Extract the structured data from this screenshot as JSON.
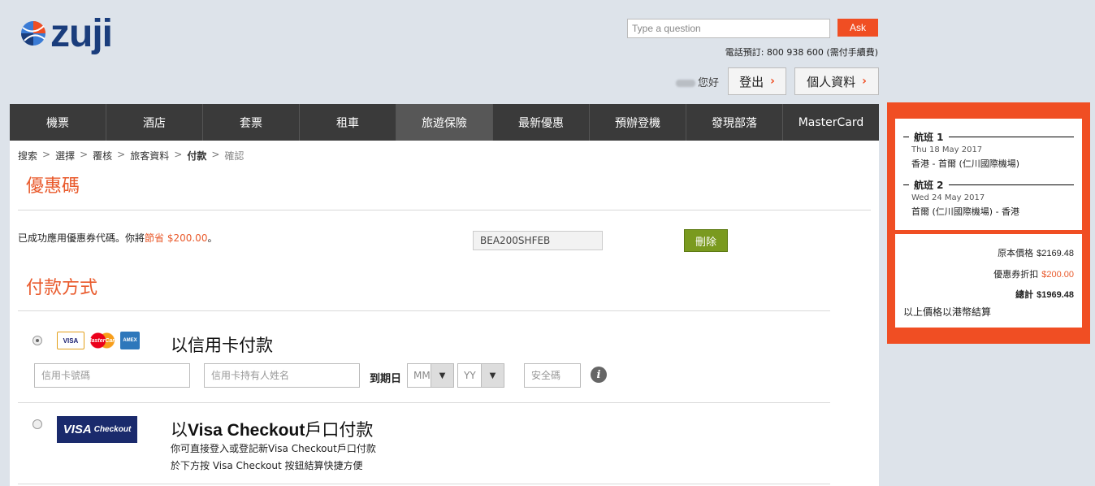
{
  "brand": {
    "name": "zuji"
  },
  "search": {
    "placeholder": "Type a question",
    "ask_label": "Ask"
  },
  "header": {
    "phone": "電話預訂: 800 938 600 (需付手續費)",
    "greeting": "您好",
    "logout_label": "登出",
    "profile_label": "個人資料"
  },
  "nav": {
    "items": [
      "機票",
      "酒店",
      "套票",
      "租車",
      "旅遊保險",
      "最新優惠",
      "預辦登機",
      "發現部落",
      "MasterCard"
    ]
  },
  "breadcrumb": {
    "items": [
      "搜索",
      "選擇",
      "覆核",
      "旅客資料",
      "付款",
      "確認"
    ],
    "current": "付款"
  },
  "promo": {
    "title": "優惠碼",
    "message_prefix": "已成功應用優惠券代碼。你將",
    "message_save": "節省 $200.00",
    "message_suffix": "。",
    "code_value": "BEA200SHFEB",
    "delete_label": "刪除"
  },
  "payment": {
    "title": "付款方式",
    "credit": {
      "title": "以信用卡付款",
      "card_logos": [
        "VISA",
        "MasterCard",
        "AMEX"
      ],
      "card_number_placeholder": "信用卡號碼",
      "holder_name_placeholder": "信用卡持有人姓名",
      "expiry_label": "到期日",
      "month_value": "MM",
      "year_value": "YY",
      "cvv_placeholder": "安全碼"
    },
    "visa_checkout": {
      "title_prefix": "以",
      "title_brand": "Visa Checkout",
      "title_suffix": "戶口付款",
      "logo_visa": "VISA",
      "logo_checkout": "Checkout",
      "desc_line1": "你可直接登入或登記新Visa Checkout戶口付款",
      "desc_line2": "於下方按 Visa Checkout 按鈕結算快捷方便"
    }
  },
  "summary": {
    "flights": [
      {
        "label": "航班 1",
        "date": "Thu 18 May 2017",
        "route": "香港 - 首爾 (仁川國際機場)"
      },
      {
        "label": "航班 2",
        "date": "Wed 24 May 2017",
        "route": "首爾 (仁川國際機場) - 香港"
      }
    ],
    "original_label": "原本價格",
    "original_amount": "$2169.48",
    "discount_label": "優惠券折扣",
    "discount_amount": "$200.00",
    "total_label": "總計",
    "total_amount": "$1969.48",
    "currency_note": "以上價格以港幣結算"
  },
  "colors": {
    "accent": "#f04e23",
    "title": "#e95a2c",
    "nav_bg": "#3a3a3a",
    "delete_btn": "#7a9a1f",
    "brand_blue": "#1a3d7c"
  }
}
